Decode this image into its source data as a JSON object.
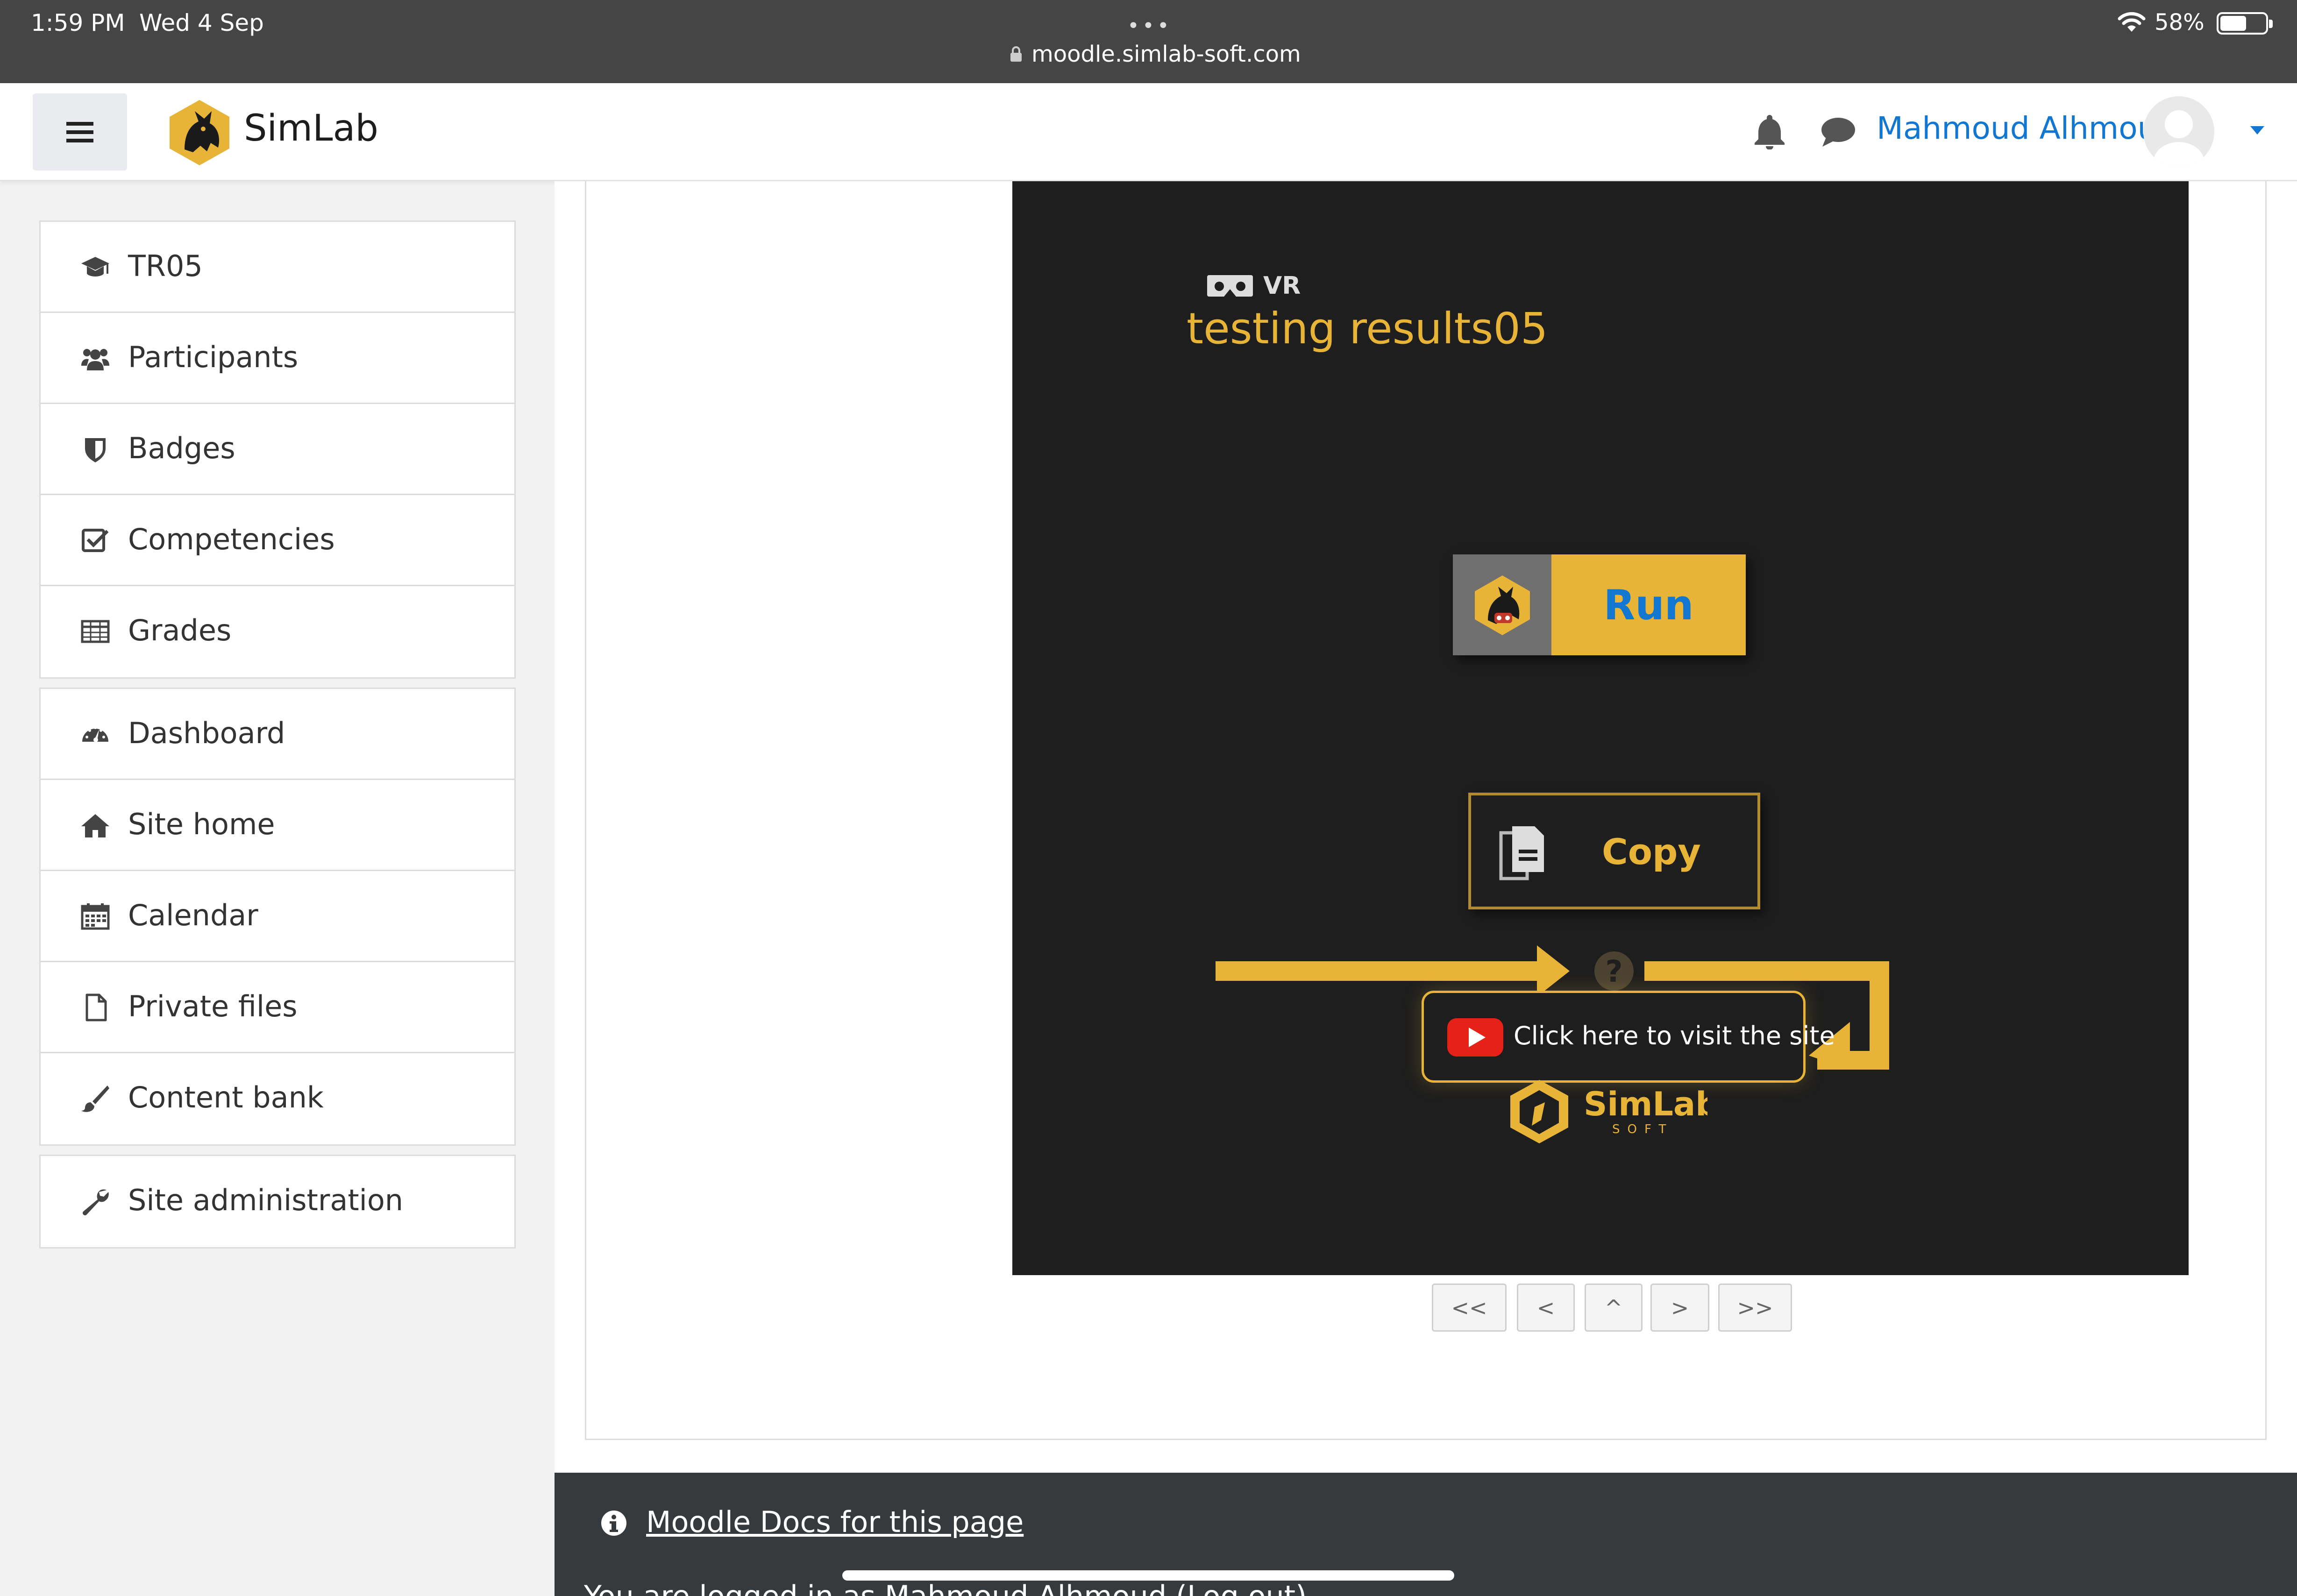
{
  "status_bar": {
    "time": "1:59 PM",
    "date": "Wed 4 Sep",
    "dots": "•••",
    "url": "moodle.simlab-soft.com",
    "battery": "58%",
    "battery_level": 0.58
  },
  "navbar": {
    "brand": "SimLab",
    "user_name": "Mahmoud Alhmoud",
    "accent_color": "#1177d1"
  },
  "drawer": {
    "course_section": [
      {
        "label": "TR05",
        "icon": "graduation-cap-icon"
      },
      {
        "label": "Participants",
        "icon": "users-icon"
      },
      {
        "label": "Badges",
        "icon": "shield-icon"
      },
      {
        "label": "Competencies",
        "icon": "check-square-icon"
      },
      {
        "label": "Grades",
        "icon": "table-icon"
      }
    ],
    "site_section": [
      {
        "label": "Dashboard",
        "icon": "dashboard-gauge-icon"
      },
      {
        "label": "Site home",
        "icon": "home-icon"
      },
      {
        "label": "Calendar",
        "icon": "calendar-icon"
      },
      {
        "label": "Private files",
        "icon": "file-icon"
      },
      {
        "label": "Content bank",
        "icon": "paintbrush-icon"
      }
    ],
    "admin_section": [
      {
        "label": "Site administration",
        "icon": "wrench-icon"
      }
    ]
  },
  "player": {
    "vr_label": "VR",
    "title": "testing results05",
    "run_label": "Run",
    "copy_label": "Copy",
    "visit_label": "Click here to visit the site",
    "help_glyph": "?",
    "logo_name": "SimLab",
    "logo_sub": "SOFT",
    "accent_color": "#e8b437"
  },
  "pager": {
    "first": "<<",
    "prev": "<",
    "up": "^",
    "next": ">",
    "last": ">>"
  },
  "footer": {
    "docs_link": "Moodle Docs for this page",
    "logged_in_text": "You are logged in as Mahmoud Alhmoud (Log out)"
  }
}
